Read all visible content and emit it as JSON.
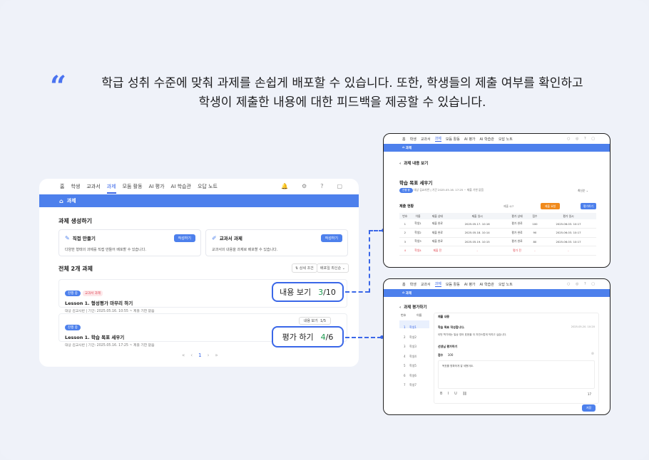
{
  "headline": {
    "line1": "학급 성취 수준에 맞춰 과제를 손쉽게 배포할 수 있습니다. 또한, 학생들의 제출 여부를 확인하고",
    "line2": "학생이 제출한 내용에 대한 피드백을 제공할 수 있습니다."
  },
  "nav": {
    "items": [
      "홈",
      "학생",
      "교과서",
      "과제",
      "모둠 활동",
      "AI 평가",
      "AI 학습관",
      "오답 노트"
    ],
    "active": "과제"
  },
  "breadcrumb": "과제",
  "create": {
    "title": "과제 생성하기",
    "direct_title": "직접 만들기",
    "direct_desc": "다양한 형태의 과제를 직접 만들어 배포할 수 있습니다.",
    "direct_btn": "작성하기",
    "textbook_title": "교과서 과제",
    "textbook_desc": "교과서의 내용을 과제로 배포할 수 있습니다.",
    "textbook_btn": "작성하기"
  },
  "list": {
    "title": "전체 2개 과제",
    "filter_label": "상세 조건",
    "sort_label": "배포일 최신순",
    "items": [
      {
        "tag": "진행 중",
        "tag2": "교과서 과제",
        "title": "Lesson 1. 형성평가 마무리 하기",
        "meta": "대상  김교사반  |  기간: 2025.05.16. 10:55 ~ 제출 기한 없음"
      },
      {
        "tag": "진행 중",
        "title": "Lesson 1. 학습 목표 세우기",
        "meta": "대상  김교사반  |  기간: 2025.05.16. 17:25 ~ 제출 기한 없음",
        "mini_label": "내용 보기",
        "mini_count": "1/5"
      }
    ]
  },
  "callouts": {
    "view": {
      "label": "내용 보기",
      "num": "3",
      "den": "/10"
    },
    "grade": {
      "label": "평가 하기",
      "num": "4",
      "den": "/6"
    }
  },
  "pager": {
    "current": "1"
  },
  "right1": {
    "breadcrumb": "과제",
    "back_title": "과제 내용 보기",
    "title": "학습 목표 세우기",
    "tag": "진행 중",
    "meta": "대상 김교사반  |  기간 2025.05.16. 17:25 ~ 제출 기한 없음",
    "sort": "최신순",
    "section": "제출 현황",
    "count": "제출 4/7",
    "btn_orange": "제출 요청",
    "btn_blue": "평가하기",
    "headers": [
      "번호",
      "이름",
      "제출 상태",
      "제출 일시",
      "평가 상태",
      "점수",
      "평가 일시"
    ],
    "rows": [
      [
        "1",
        "학생1",
        "제출 완료",
        "2025.05.17. 10:16",
        "평가 완료",
        "100",
        "2025.06.03. 10:17"
      ],
      [
        "2",
        "학생2",
        "제출 완료",
        "2025.05.18. 10:14",
        "평가 완료",
        "90",
        "2025.06.03. 10:17"
      ],
      [
        "3",
        "학생3",
        "제출 완료",
        "2025.05.19. 10:15",
        "평가 완료",
        "80",
        "2025.06.03. 10:17"
      ],
      [
        "4",
        "학생4",
        "제출 전",
        "-",
        "평가 전",
        "-",
        "-"
      ]
    ]
  },
  "right2": {
    "breadcrumb": "과제",
    "back_title": "과제 평가하기",
    "col_num": "번호",
    "col_name": "이름",
    "students": [
      "학생1",
      "학생2",
      "학생3",
      "학생4",
      "학생5",
      "학생6",
      "학생7"
    ],
    "content_label": "제출 내용",
    "answer_title": "학습 목표 작성합니다.",
    "answer_date": "2025.05.20. 10:20",
    "answer_text": "이번 학기에는 일상 영어 표현을 더 자연스럽게 익히고 싶습니다.",
    "feedback_title": "선생님 평가하기",
    "score_label": "점수",
    "score_value": "100",
    "feedback_text": "목표를 명확하게 잘 세웠어요.",
    "char_count": "17",
    "save_btn": "저장"
  },
  "colors": {
    "accent": "#4d80ec",
    "success": "#1f9a50",
    "danger": "#e0454f"
  }
}
